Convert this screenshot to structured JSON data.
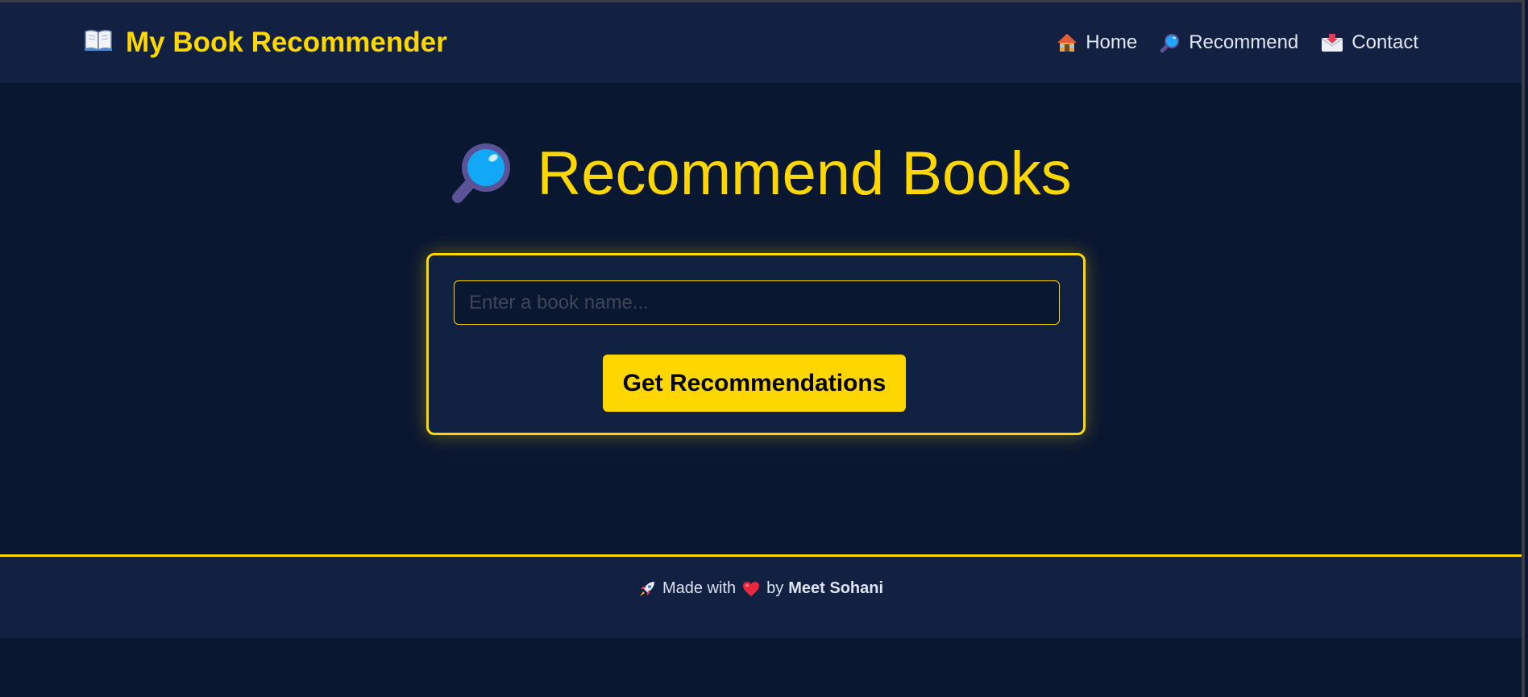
{
  "navbar": {
    "brand": "My Book Recommender",
    "brand_icon": "open-book-icon",
    "links": [
      {
        "label": "Home",
        "icon": "house-icon"
      },
      {
        "label": "Recommend",
        "icon": "magnifier-icon"
      },
      {
        "label": "Contact",
        "icon": "envelope-icon"
      }
    ]
  },
  "main": {
    "title": "Recommend Books",
    "title_icon": "magnifier-icon",
    "search": {
      "placeholder": "Enter a book name...",
      "value": "",
      "button_label": "Get Recommendations"
    }
  },
  "footer": {
    "made_with": "Made with",
    "by": "by",
    "author": "Meet Sohani",
    "icons": [
      "rocket-icon",
      "heart-icon"
    ]
  },
  "colors": {
    "background": "#0a1730",
    "navbar": "#122142",
    "accent": "#ffd700",
    "text": "#e1e6f2"
  }
}
